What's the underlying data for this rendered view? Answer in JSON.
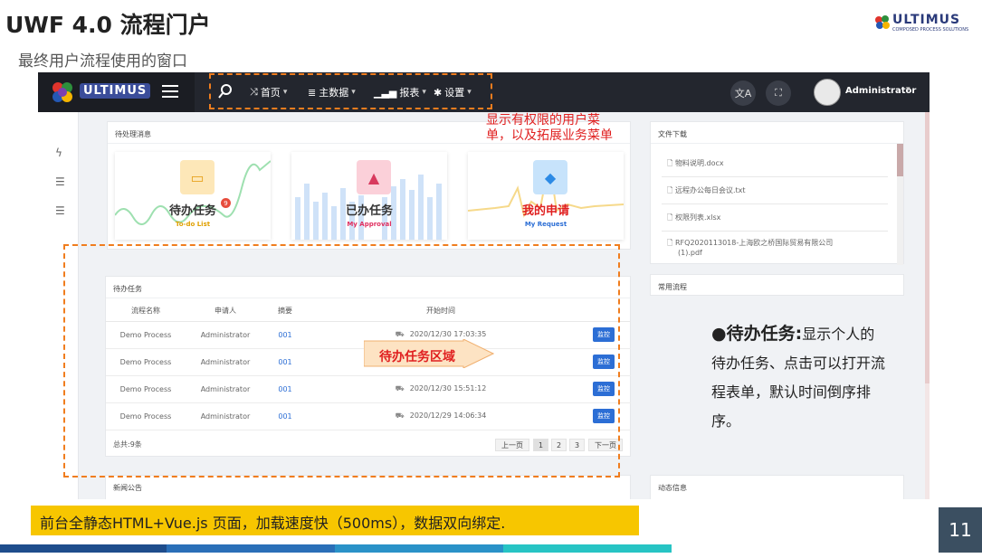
{
  "slide": {
    "title": "UWF 4.0 流程门户",
    "subtitle": "最终用户流程使用的窗口",
    "brand_word": "ULTIMUS",
    "brand_tag": "COMPOSED PROCESS SOLUTIONS",
    "page_number": "11",
    "footer_note": "前台全静态HTML+Vue.js 页面，加载速度快（500ms），数据双向绑定."
  },
  "app": {
    "logo_text": "ULTIMUS",
    "nav": [
      {
        "label": "首页",
        "icon": "shuffle-icon"
      },
      {
        "label": "主数据",
        "icon": "database-icon"
      },
      {
        "label": "报表",
        "icon": "bar-chart-icon"
      },
      {
        "label": "设置",
        "icon": "gear-icon"
      }
    ],
    "user_name": "Administrator",
    "pending_panel": {
      "title": "待处理消息",
      "cards": [
        {
          "label": "待办任务",
          "sub": "To-do List",
          "badge": "9",
          "color": "#333333",
          "sub_color": "#e0a000"
        },
        {
          "label": "已办任务",
          "sub": "My Approval",
          "color": "#333333",
          "sub_color": "#e03060"
        },
        {
          "label": "我的申请",
          "sub": "My Request",
          "color": "#e02020",
          "sub_color": "#2c6ed5"
        }
      ]
    },
    "todo_panel": {
      "title": "待办任务",
      "columns": [
        "流程名称",
        "申请人",
        "摘要",
        "开始时间"
      ],
      "rows": [
        {
          "name": "Demo Process",
          "applicant": "Administrator",
          "summary": "001",
          "time": "2020/12/30 17:03:35",
          "action": "监控"
        },
        {
          "name": "Demo Process",
          "applicant": "Administrator",
          "summary": "001",
          "time": "",
          "action": "监控"
        },
        {
          "name": "Demo Process",
          "applicant": "Administrator",
          "summary": "001",
          "time": "2020/12/30 15:51:12",
          "action": "监控"
        },
        {
          "name": "Demo Process",
          "applicant": "Administrator",
          "summary": "001",
          "time": "2020/12/29 14:06:34",
          "action": "监控"
        }
      ],
      "total": "总共:9条",
      "pager": {
        "prev": "上一页",
        "pages": [
          "1",
          "2",
          "3"
        ],
        "next": "下一页"
      }
    },
    "news_panel": {
      "title": "新闻公告"
    },
    "files_panel": {
      "title": "文件下载",
      "files": [
        "物料说明.docx",
        "远程办公每日会议.txt",
        "权限列表.xlsx",
        "RFQ2020113018-上海欧之桥国际贸易有限公司",
        "(1).pdf"
      ]
    },
    "common_panel": {
      "title": "常用流程"
    },
    "activity_panel": {
      "title": "动态信息"
    }
  },
  "annotations": {
    "menu_note": "显示有权限的用户菜单，以及拓展业务菜单",
    "area_label": "待办任务区域",
    "bullet_title": "●待办任务:",
    "bullet_body": "显示个人的待办任务、点击可以打开流程表单，默认时间倒序排序。"
  }
}
